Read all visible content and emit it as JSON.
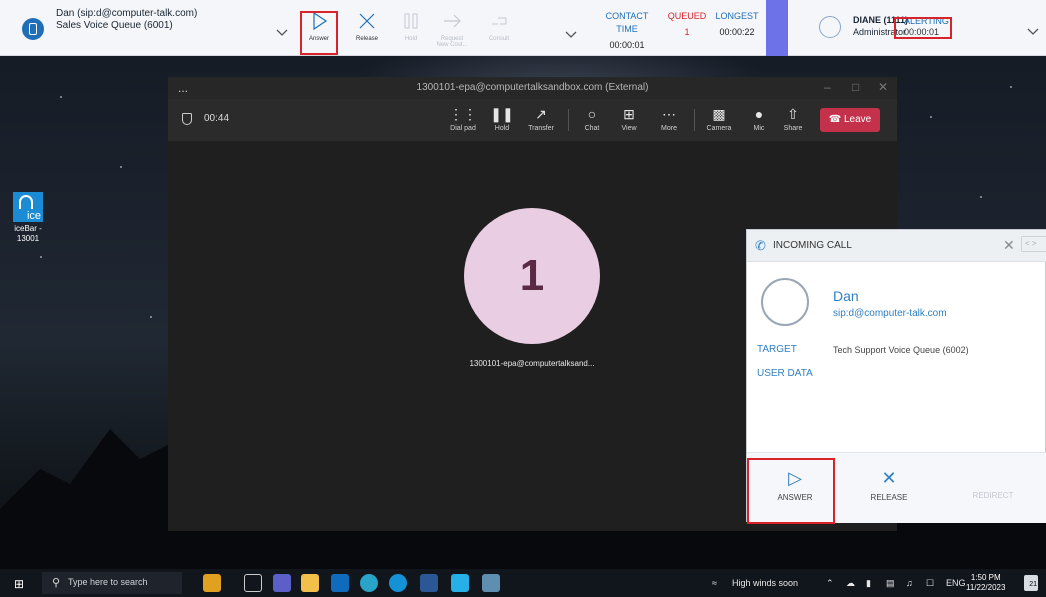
{
  "topbar": {
    "caller_name": "Dan (sip:d@computer-talk.com)",
    "caller_queue": "Sales Voice Queue (6001)",
    "buttons": {
      "answer": "Answer",
      "release": "Release",
      "hold": "Hold",
      "request_line1": "Request",
      "request_line2": "New Cost...",
      "consult": "Consult"
    },
    "stats": {
      "contact_time_label": "CONTACT TIME",
      "contact_time_value": "00:00:01",
      "queued_label": "QUEUED",
      "queued_value": "1",
      "longest_label": "LONGEST",
      "longest_value": "00:00:22"
    },
    "user_name": "DIANE (1111)",
    "user_role": "Administrator",
    "status_label": "ALERTING",
    "status_time": "00:00:01",
    "accent_color": "#1f6fb8",
    "highlight_color": "#d8232a"
  },
  "desktop": {
    "icon_label_line1": "iceBar -",
    "icon_label_line2": "13001",
    "icon_badge": "ice"
  },
  "teams": {
    "window_title": "1300101-epa@computertalksandbox.com (External)",
    "menu_dots": "...",
    "timer": "00:44",
    "controls": {
      "dial_pad": "Dial pad",
      "hold": "Hold",
      "transfer": "Transfer",
      "chat": "Chat",
      "view": "View",
      "more": "More",
      "camera": "Camera",
      "mic": "Mic",
      "share": "Share",
      "leave": "Leave"
    },
    "avatar_initial": "1",
    "caller_display": "1300101-epa@computertalksand..."
  },
  "popup": {
    "title": "INCOMING CALL",
    "caller_name": "Dan",
    "caller_sip": "sip:d@computer-talk.com",
    "target_label": "TARGET",
    "target_value": "Tech Support Voice Queue (6002)",
    "user_data_label": "USER DATA",
    "answer": "ANSWER",
    "release": "RELEASE",
    "redirect": "REDIRECT"
  },
  "taskbar": {
    "search_placeholder": "Type here to search",
    "weather": "High winds soon",
    "language": "ENG",
    "time": "1:50 PM",
    "date": "11/22/2023",
    "notification_count": "21"
  }
}
